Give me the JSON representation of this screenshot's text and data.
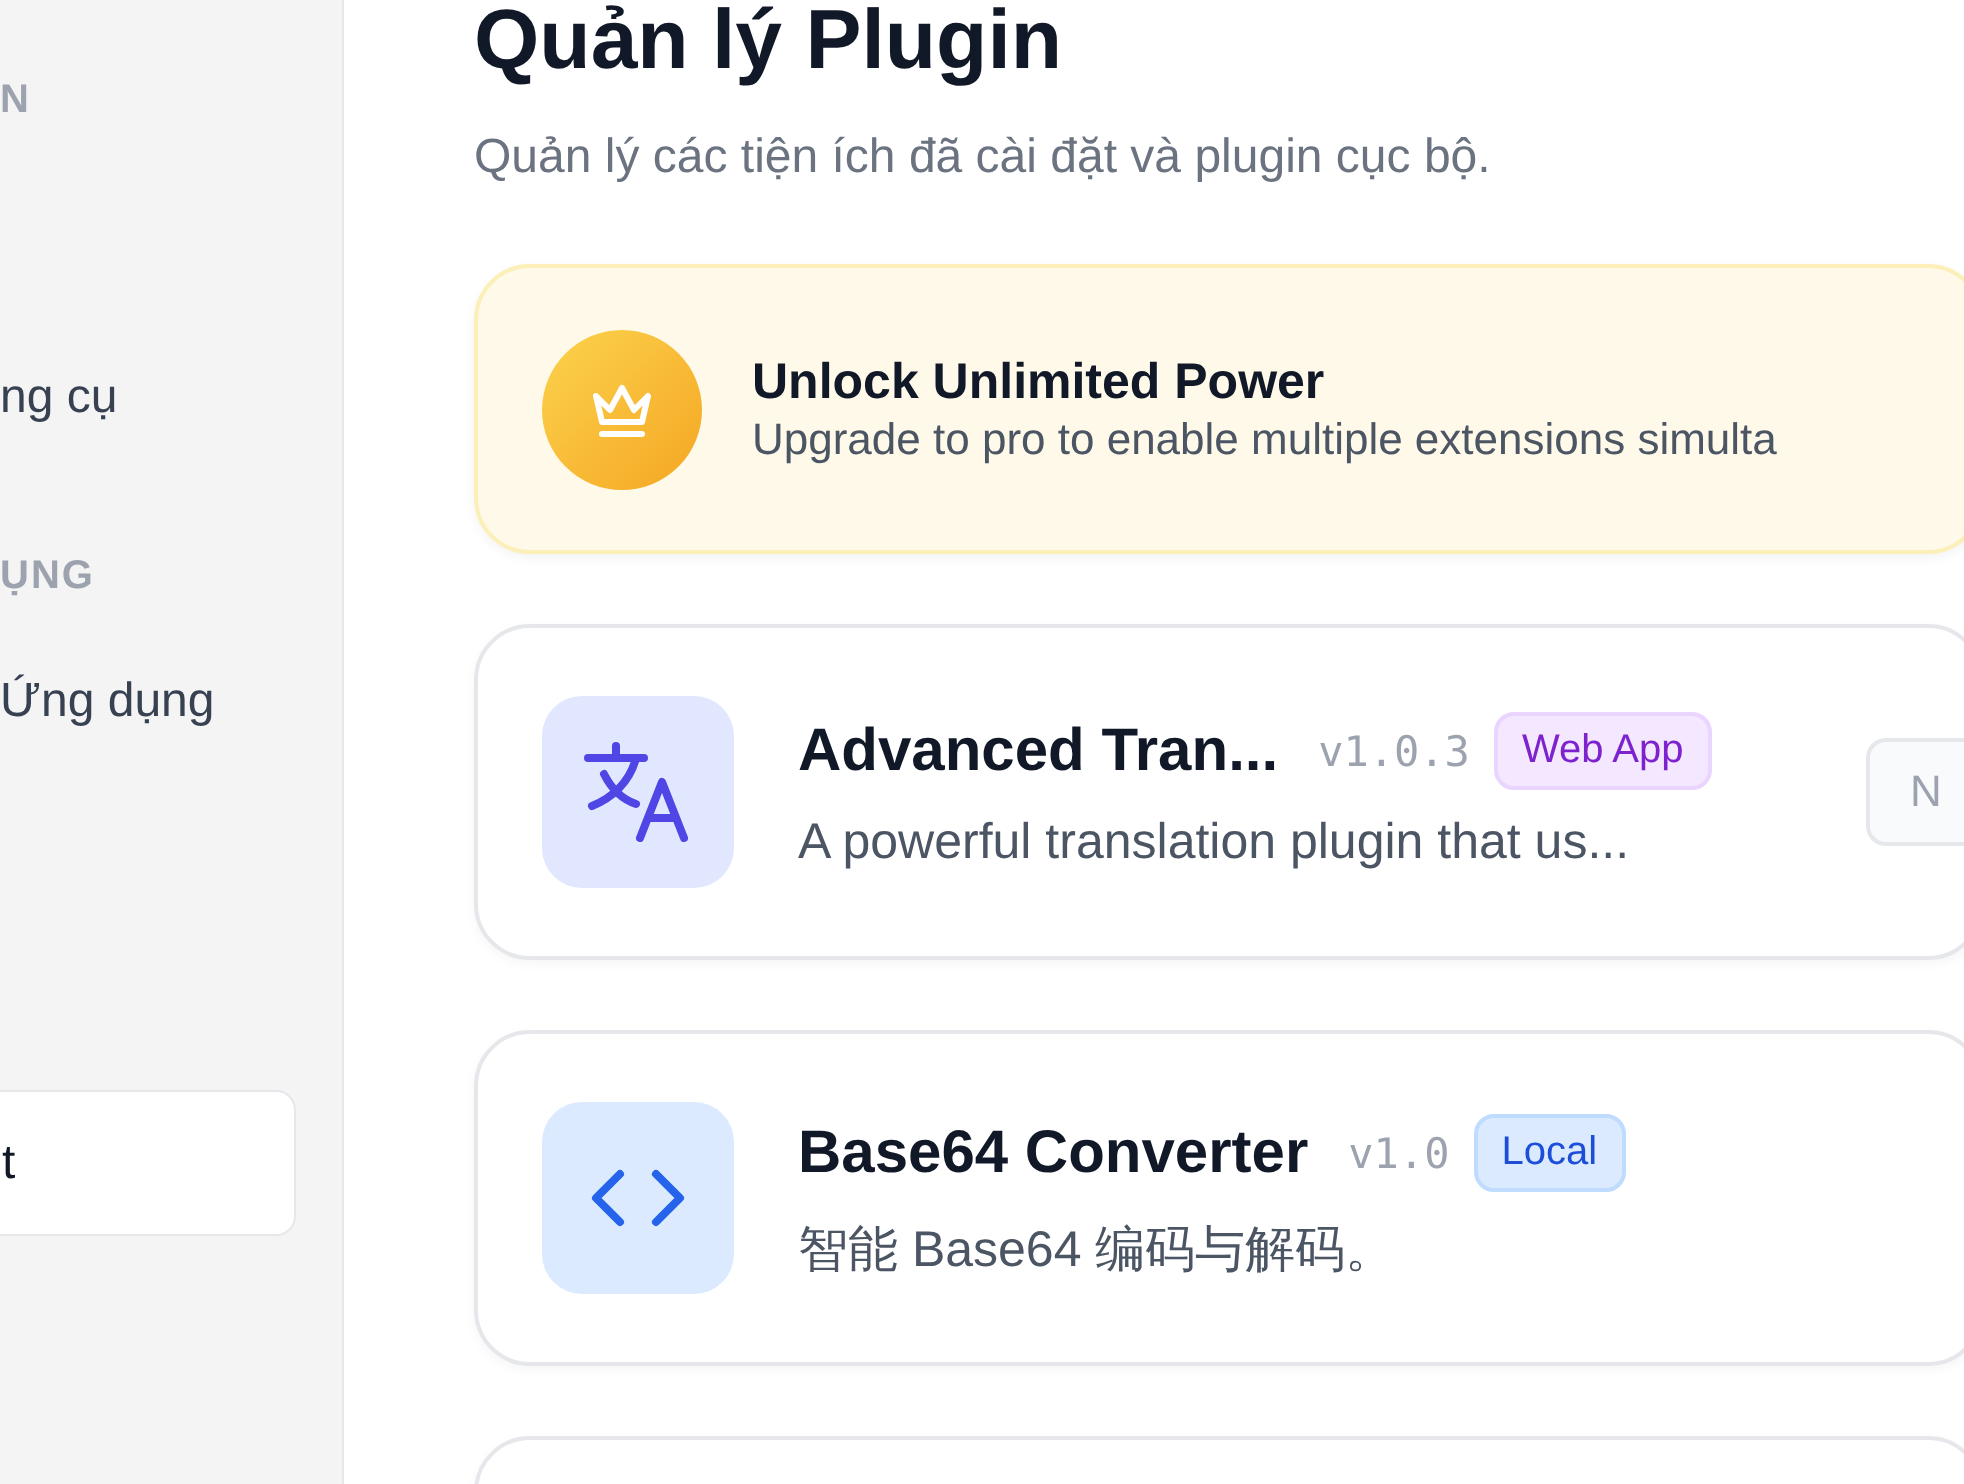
{
  "sidebar": {
    "sections": [
      {
        "label": "N",
        "items": [
          "ng cụ"
        ]
      },
      {
        "label": "ỤNG",
        "items": [
          "Ứng dụng"
        ]
      }
    ],
    "footer_button": "t"
  },
  "page": {
    "title": "Quản lý Plugin",
    "subtitle": "Quản lý các tiện ích đã cài đặt và plugin cục bộ."
  },
  "banner": {
    "title": "Unlock Unlimited Power",
    "text": "Upgrade to pro to enable multiple extensions simulta"
  },
  "plugins": [
    {
      "kind": "translate",
      "name": "Advanced Tran...",
      "version": "v1.0.3",
      "badge": {
        "label": "Web App",
        "kind": "web_app"
      },
      "description": "A powerful translation plugin that us...",
      "action": "N"
    },
    {
      "kind": "code",
      "name": "Base64 Converter",
      "version": "v1.0",
      "badge": {
        "label": "Local",
        "kind": "local"
      },
      "description": "智能 Base64 编码与解码。"
    },
    {
      "kind": "blank"
    }
  ]
}
